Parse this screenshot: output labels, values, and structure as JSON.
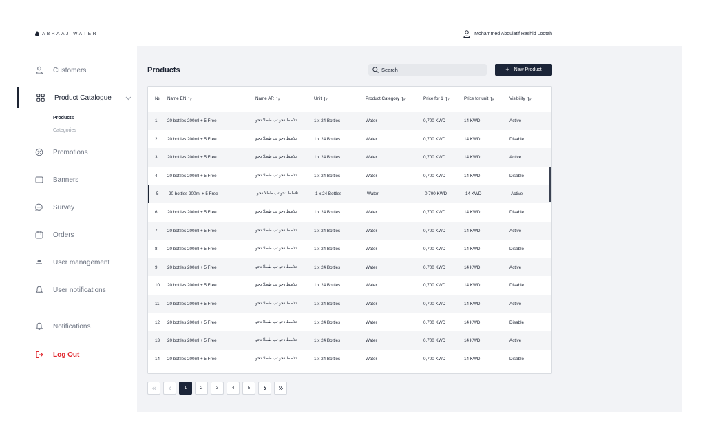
{
  "brand": {
    "name": "ABRAAJ WATER"
  },
  "user": {
    "name": "Mohammed Abdulatif Rashid Lootah"
  },
  "sidebar": {
    "items": [
      {
        "label": "Customers",
        "icon": "user-icon"
      },
      {
        "label": "Product Catalogue",
        "icon": "grid-icon",
        "active": true,
        "sub": [
          {
            "label": "Products",
            "active": true
          },
          {
            "label": "Categories"
          }
        ]
      },
      {
        "label": "Promotions",
        "icon": "promotion-icon"
      },
      {
        "label": "Banners",
        "icon": "banner-icon"
      },
      {
        "label": "Survey",
        "icon": "chat-icon"
      },
      {
        "label": "Orders",
        "icon": "orders-icon"
      },
      {
        "label": "User management",
        "icon": "users-icon"
      },
      {
        "label": "User notifications",
        "icon": "bell-icon"
      }
    ],
    "notifications_label": "Notifications",
    "logout_label": "Log Out",
    "logout_color": "#e0262d"
  },
  "main": {
    "title": "Products",
    "search_placeholder": "Search",
    "new_button_label": "New Product",
    "accent_color": "#1c2538"
  },
  "table": {
    "columns": [
      "№",
      "Name EN",
      "Name AR",
      "Unit",
      "Product Category",
      "Price for 1",
      "Price for unit",
      "Visibility"
    ],
    "rows": [
      [
        "1",
        "20 bottles 200ml + 5 Free",
        "تلاطط دحو تب ططلا دحو",
        "1 x 24 Bottles",
        "Water",
        "0,700 KWD",
        "14 KWD",
        "Active"
      ],
      [
        "2",
        "20 bottles 200ml + 5 Free",
        "تلاطط دحو تب ططلا دحو",
        "1 x 24 Bottles",
        "Water",
        "0,700 KWD",
        "14 KWD",
        "Disable"
      ],
      [
        "3",
        "20 bottles 200ml + 5 Free",
        "تلاطط دحو تب ططلا دحو",
        "1 x 24 Bottles",
        "Water",
        "0,700 KWD",
        "14 KWD",
        "Active"
      ],
      [
        "4",
        "20 bottles 200ml + 5 Free",
        "تلاطط دحو تب ططلا دحو",
        "1 x 24 Bottles",
        "Water",
        "0,700 KWD",
        "14 KWD",
        "Disable"
      ],
      [
        "5",
        "20 bottles 200ml + 5 Free",
        "تلاطط دحو تب ططلا دحو",
        "1 x 24 Bottles",
        "Water",
        "0,700 KWD",
        "14 KWD",
        "Active"
      ],
      [
        "6",
        "20 bottles 200ml + 5 Free",
        "تلاطط دحو تب ططلا دحو",
        "1 x 24 Bottles",
        "Water",
        "0,700 KWD",
        "14 KWD",
        "Disable"
      ],
      [
        "7",
        "20 bottles 200ml + 5 Free",
        "تلاطط دحو تب ططلا دحو",
        "1 x 24 Bottles",
        "Water",
        "0,700 KWD",
        "14 KWD",
        "Active"
      ],
      [
        "8",
        "20 bottles 200ml + 5 Free",
        "تلاطط دحو تب ططلا دحو",
        "1 x 24 Bottles",
        "Water",
        "0,700 KWD",
        "14 KWD",
        "Disable"
      ],
      [
        "9",
        "20 bottles 200ml + 5 Free",
        "تلاطط دحو تب ططلا دحو",
        "1 x 24 Bottles",
        "Water",
        "0,700 KWD",
        "14 KWD",
        "Active"
      ],
      [
        "10",
        "20 bottles 200ml + 5 Free",
        "تلاطط دحو تب ططلا دحو",
        "1 x 24 Bottles",
        "Water",
        "0,700 KWD",
        "14 KWD",
        "Disable"
      ],
      [
        "11",
        "20 bottles 200ml + 5 Free",
        "تلاطط دحو تب ططلا دحو",
        "1 x 24 Bottles",
        "Water",
        "0,700 KWD",
        "14 KWD",
        "Active"
      ],
      [
        "12",
        "20 bottles 200ml + 5 Free",
        "تلاطط دحو تب ططلا دحو",
        "1 x 24 Bottles",
        "Water",
        "0,700 KWD",
        "14 KWD",
        "Disable"
      ],
      [
        "13",
        "20 bottles 200ml + 5 Free",
        "تلاطط دحو تب ططلا دحو",
        "1 x 24 Bottles",
        "Water",
        "0,700 KWD",
        "14 KWD",
        "Active"
      ],
      [
        "14",
        "20 bottles 200ml + 5 Free",
        "تلاطط دحو تب ططلا دحو",
        "1 x 24 Bottles",
        "Water",
        "0,700 KWD",
        "14 KWD",
        "Disable"
      ]
    ],
    "selected_row": "5"
  },
  "pagination": {
    "pages": [
      "1",
      "2",
      "3",
      "4",
      "5"
    ],
    "current": "1"
  }
}
